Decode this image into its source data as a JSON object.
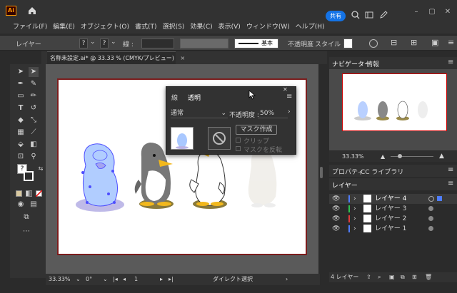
{
  "app": {
    "logo": "Ai",
    "share_label": "共有"
  },
  "menu": [
    "ファイル(F)",
    "編集(E)",
    "オブジェクト(O)",
    "書式(T)",
    "選択(S)",
    "効果(C)",
    "表示(V)",
    "ウィンドウ(W)",
    "ヘルプ(H)"
  ],
  "control": {
    "selection_label": "レイヤー",
    "q1": "?",
    "q2": "?",
    "stroke_label": "線 :",
    "brush_label": "基本",
    "opacity_label": "不透明度",
    "style_label": "スタイル :"
  },
  "document_tab": {
    "label": "名称未設定.ai* @ 33.33 % (CMYK/プレビュー)",
    "close": "×"
  },
  "transparency_panel": {
    "tab_stroke": "線",
    "tab_transparency": "透明",
    "blend_mode": "通常",
    "opacity_label": "不透明度 :",
    "opacity_value": "50%",
    "make_mask_label": "マスク作成",
    "clip_label": "クリップ",
    "invert_label": "マスクを反転",
    "menu_icon": "menu-icon"
  },
  "status": {
    "zoom": "33.33%",
    "rotation": "0°",
    "artboard": "1",
    "tool": "ダイレクト選択"
  },
  "panels": {
    "navigator_tab": "ナビゲーター",
    "info_tab": "情報",
    "nav_zoom": "33.33%",
    "properties_tab": "プロパティ",
    "cc_library_tab": "CC ライブラリ",
    "layers_tab": "レイヤー"
  },
  "layers": [
    {
      "name": "レイヤー 4",
      "color": "#4f7dff",
      "selected": true
    },
    {
      "name": "レイヤー 3",
      "color": "#2ec24f",
      "selected": false
    },
    {
      "name": "レイヤー 2",
      "color": "#e23b3b",
      "selected": false
    },
    {
      "name": "レイヤー 1",
      "color": "#4f7dff",
      "selected": false
    }
  ],
  "layers_footer": {
    "count": "4 レイヤー"
  },
  "colors": {
    "accent": "#1473e6",
    "artboard_border": "#7b1c1c",
    "selection_blue": "#3a3aff"
  }
}
